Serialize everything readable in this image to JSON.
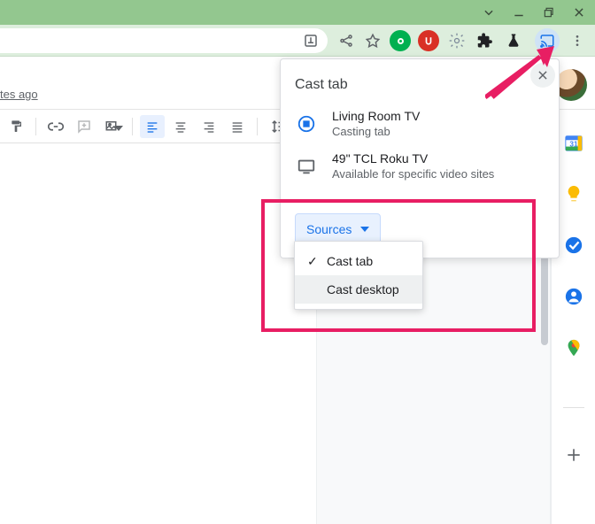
{
  "doc": {
    "edited_text": "tes ago"
  },
  "side": {
    "calendar_day": "31"
  },
  "cast": {
    "title": "Cast tab",
    "devices": [
      {
        "name": "Living Room TV",
        "status": "Casting tab"
      },
      {
        "name": "49\" TCL Roku TV",
        "status": "Available for specific video sites"
      }
    ],
    "sources_label": "Sources",
    "menu": [
      {
        "label": "Cast tab",
        "selected": true
      },
      {
        "label": "Cast desktop",
        "selected": false
      }
    ]
  }
}
